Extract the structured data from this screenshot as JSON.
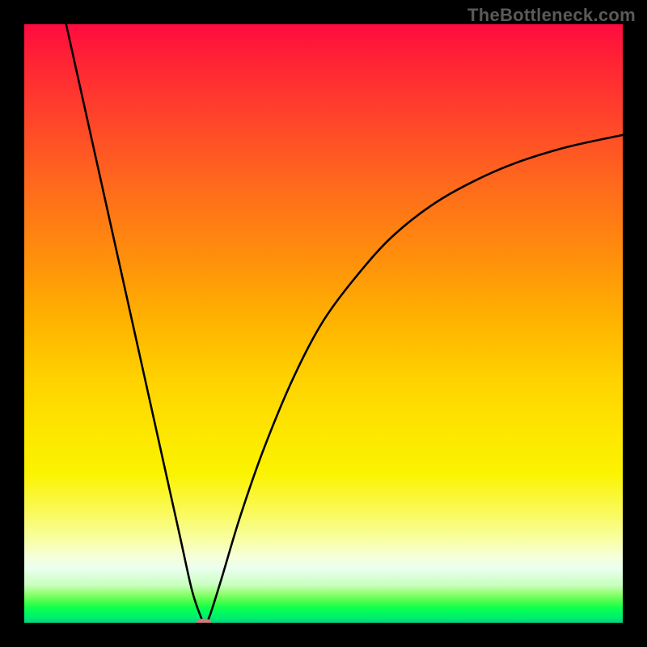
{
  "watermark": "TheBottleneck.com",
  "chart_data": {
    "type": "line",
    "title": "",
    "xlabel": "",
    "ylabel": "",
    "xlim": [
      0,
      100
    ],
    "ylim": [
      0,
      100
    ],
    "grid": false,
    "background_gradient": [
      "#ff0b3f",
      "#ffd400",
      "#fbf300",
      "#00d883"
    ],
    "series": [
      {
        "name": "curve",
        "x": [
          7,
          10,
          14,
          17,
          20,
          23,
          26,
          28,
          29.5,
          30.2,
          31,
          33,
          36,
          40,
          45,
          50,
          56,
          62,
          70,
          80,
          90,
          100
        ],
        "y": [
          100,
          86.5,
          68.5,
          55.0,
          41.5,
          28.0,
          14.5,
          5.5,
          1.0,
          0.0,
          1.2,
          7.5,
          17.5,
          29.0,
          41.0,
          50.5,
          58.5,
          65.0,
          71.0,
          76.0,
          79.3,
          81.5
        ]
      }
    ],
    "marker": {
      "x": 30,
      "y": 0,
      "rx": 1.3,
      "ry": 0.7,
      "color": "#d07a7a"
    }
  }
}
